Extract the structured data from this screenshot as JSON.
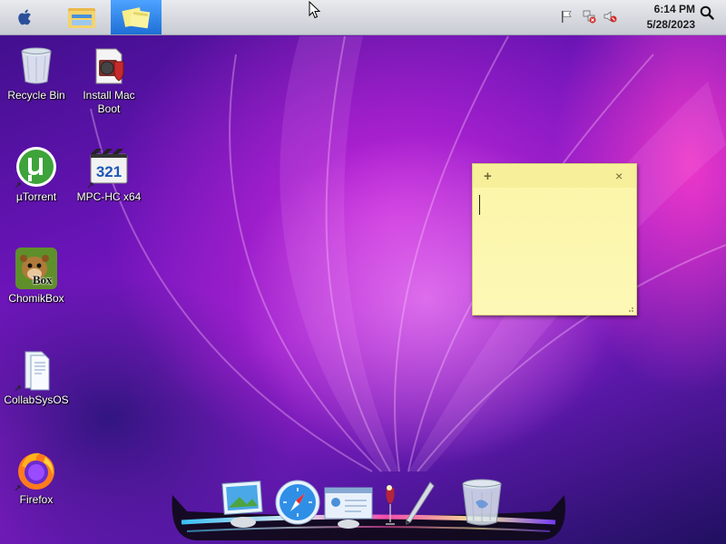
{
  "taskbar": {
    "clock_time": "6:14 PM",
    "clock_date": "5/28/2023"
  },
  "desktop_icons": [
    {
      "label": "Recycle Bin"
    },
    {
      "label": "Install Mac Boot"
    },
    {
      "label": "µTorrent"
    },
    {
      "label": "MPC-HC x64"
    },
    {
      "label": "ChomikBox"
    },
    {
      "label": "CollabSysOS"
    },
    {
      "label": "Firefox"
    }
  ],
  "mpc_badge": "321",
  "chomik_badge": "Box",
  "sticky_note": {
    "add_glyph": "+",
    "close_glyph": "×",
    "text": ""
  },
  "colors": {
    "topbar": "#d8dae0",
    "accent": "#1e6fd6",
    "sticky": "#fdf8b6"
  }
}
